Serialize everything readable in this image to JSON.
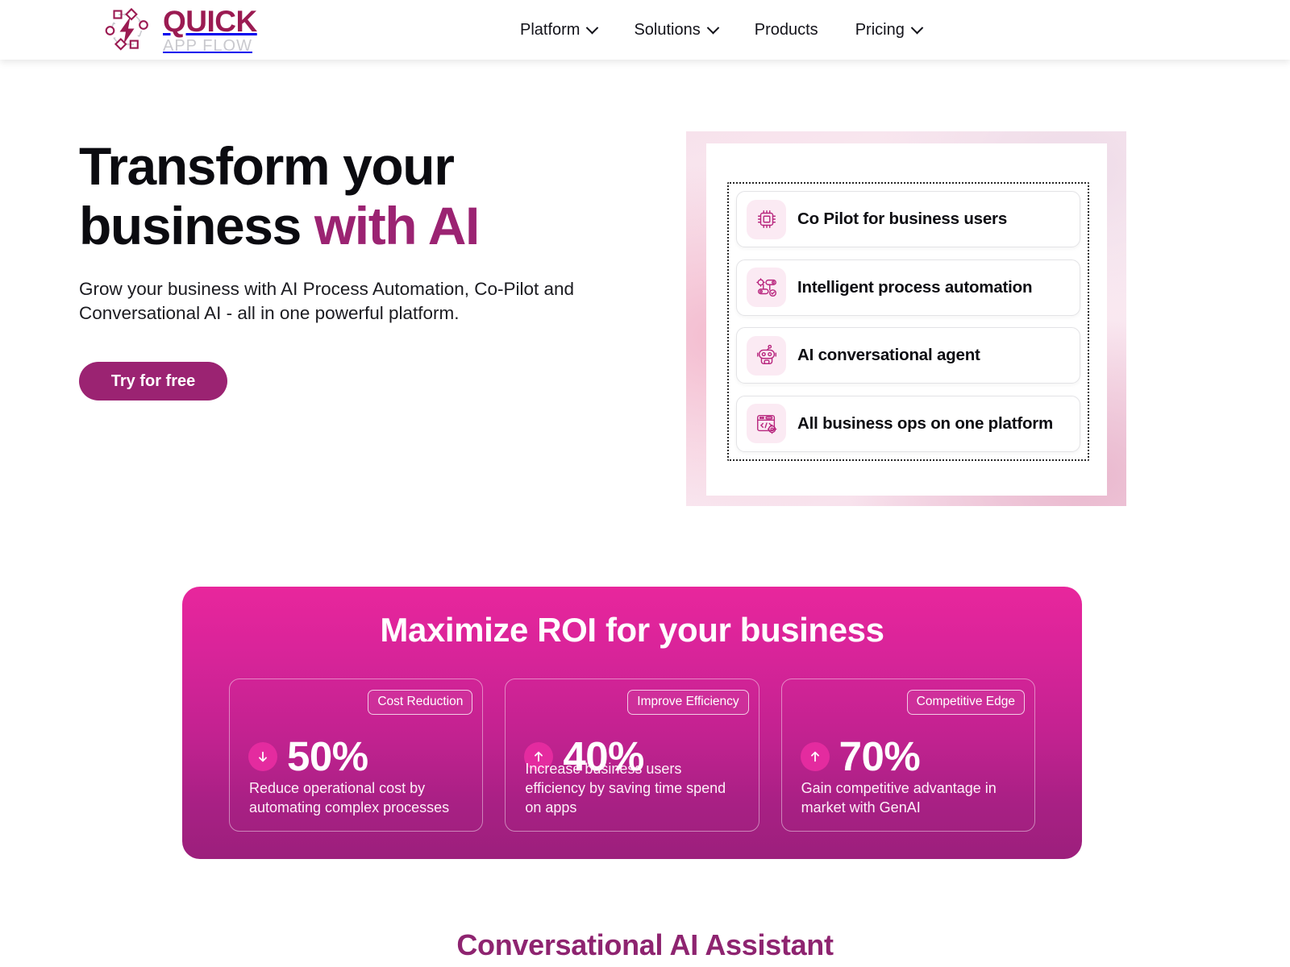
{
  "header": {
    "logo": {
      "mark_icon": "workflow-lightning-icon",
      "primary_text": "QUICK",
      "secondary_text": "APP FLOW"
    },
    "nav": [
      {
        "label": "Platform",
        "has_dropdown": true,
        "icon": "chevron-down-icon"
      },
      {
        "label": "Solutions",
        "has_dropdown": true,
        "icon": "chevron-down-icon"
      },
      {
        "label": "Products",
        "has_dropdown": false,
        "icon": ""
      },
      {
        "label": "Pricing",
        "has_dropdown": true,
        "icon": "chevron-down-icon"
      }
    ]
  },
  "hero": {
    "title_line1": "Transform your",
    "title_line2_plain": "business ",
    "title_line2_accent": "with AI",
    "subtitle": "Grow your business with AI Process Automation, Co-Pilot and Conversational AI - all in one powerful platform.",
    "cta_label": "Try for free",
    "features": [
      {
        "label": "Co Pilot for business users",
        "icon": "ai-chip-icon"
      },
      {
        "label": "Intelligent process automation",
        "icon": "process-flow-gear-icon"
      },
      {
        "label": "AI conversational agent",
        "icon": "robot-icon"
      },
      {
        "label": "All business ops on one platform",
        "icon": "browser-code-gear-icon"
      }
    ]
  },
  "roi": {
    "title": "Maximize ROI for your business",
    "cards": [
      {
        "badge": "Cost Reduction",
        "value": "50%",
        "direction": "down",
        "arrow_icon": "arrow-down-icon",
        "description": "Reduce operational cost by automating complex processes"
      },
      {
        "badge": "Improve Efficiency",
        "value": "40%",
        "direction": "up",
        "arrow_icon": "arrow-up-icon",
        "description": "Increase business users efficiency by saving time spend on apps"
      },
      {
        "badge": "Competitive Edge",
        "value": "70%",
        "direction": "up",
        "arrow_icon": "arrow-up-icon",
        "description": "Gain competitive advantage in market with GenAI"
      }
    ]
  },
  "next_section": {
    "title": "Conversational AI Assistant"
  },
  "colors": {
    "brand_crimson": "#9B1B52",
    "brand_magenta": "#9B2372",
    "banner_top": "#E8269C",
    "banner_bottom": "#9C1F7C",
    "accent_pink": "#E42B9F",
    "logo_gray": "#c9c9ce"
  }
}
